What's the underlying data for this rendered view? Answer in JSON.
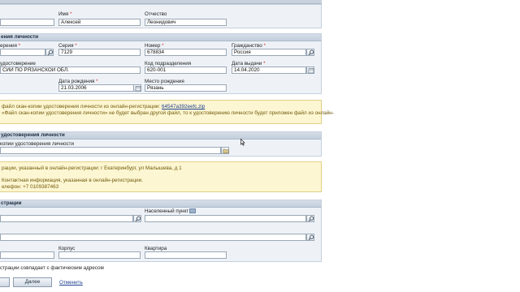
{
  "name_section": {
    "first_name_label": "Имя",
    "first_name_value": "Алексей",
    "patronymic_label": "Отчество",
    "patronymic_value": "Леонидович"
  },
  "document_section": {
    "title": "ения личности",
    "type_label": "ерения",
    "series_label": "Серия",
    "series_value": "7129",
    "number_label": "Номер",
    "number_value": "678834",
    "citizenship_label": "Гражданство",
    "citizenship_value": "Россия",
    "issued_by_label": "удостоверение",
    "issued_by_value": "СИИ ПО РЯЗАНСКОЙ ОБЛ.",
    "division_code_label": "Код подразделения",
    "division_code_value": "620-001",
    "issue_date_label": "Дата выдачи",
    "issue_date_value": "14.04.2020",
    "birth_date_label": "Дата рождения",
    "birth_date_value": "21.03.2006",
    "birth_place_label": "Место рождения",
    "birth_place_value": "Рязань"
  },
  "scan_notice": {
    "line1_prefix": "файл скан-копии удостоверения личности из онлайн-регистрации:",
    "line1_link": "64547a392eefc.zip",
    "line2": "«Файл скан-копии удостоверения личности» не будет выбран другой файл, то к удостоверению личности будет приложен файл из онлайн-"
  },
  "scan_section": {
    "title": "удостоверения личности",
    "file_label": "копии удостоверения личности"
  },
  "address_notice": {
    "line1": "рации, указанный в онлайн-регистрации: г Екатеринбург, ул Малышева, д 1",
    "line2": "Контактная информация, указанная в онлайн-регистрации.",
    "line3": "елефон: +7 0109387463"
  },
  "registration_section": {
    "title": "страции",
    "locality_label": "Населенный пункт",
    "building_label": "Корпус",
    "apartment_label": "Квартира"
  },
  "same_address_label": "страции совпадает с фактическим адресом",
  "buttons": {
    "next": "Далее",
    "cancel": "Отменить"
  }
}
